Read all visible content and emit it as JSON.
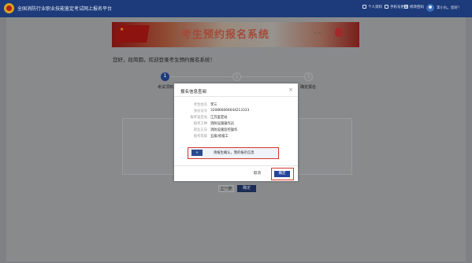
{
  "topbar": {
    "title": "全国消防行业职业技能鉴定考试网上报名平台",
    "items": [
      "个人资料",
      "手机号更换",
      "修改密码"
    ],
    "user": "李小丸，您好！"
  },
  "banner": {
    "title": "考生预约报名系统"
  },
  "welcome": "您好，段简圆，欢迎登录考生预约报名系统！",
  "steps": [
    {
      "number": "1",
      "label": "考试须知"
    },
    {
      "number": "2",
      "label": ""
    },
    {
      "number": "3",
      "label": "确定报名"
    }
  ],
  "buttons": {
    "prev": "上一步",
    "next": "确定"
  },
  "modal": {
    "title": "报名信息查阅",
    "close": "×",
    "rows": [
      {
        "label": "考生姓名",
        "value": "李三"
      },
      {
        "label": "身份证号",
        "value": "320866666644213333"
      },
      {
        "label": "报考鉴定站",
        "value": "江苏鉴定站"
      },
      {
        "label": "报考工种",
        "value": "消防设施操作员"
      },
      {
        "label": "职业方向",
        "value": "消防设施监控操作"
      },
      {
        "label": "报考等级",
        "value": "五级/初级工"
      }
    ],
    "notice_icon": "»",
    "notice": "请报生确认，我的报名信息",
    "cancel": "取消",
    "ok": "确定"
  }
}
